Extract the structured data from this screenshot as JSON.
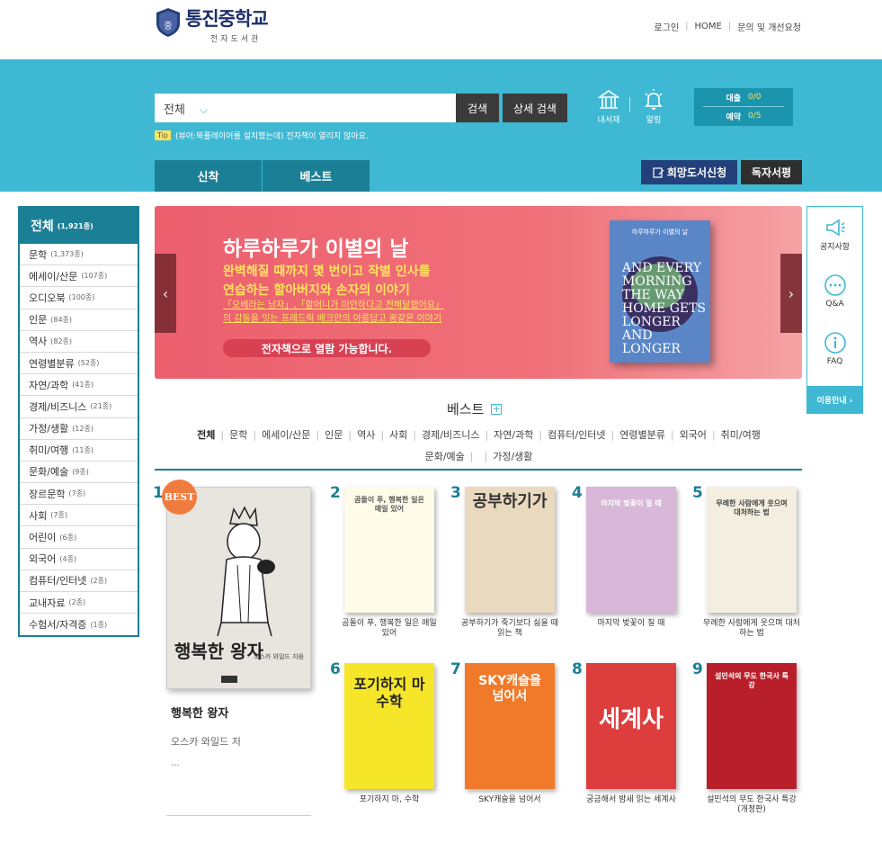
{
  "header": {
    "school_name": "통진중학교",
    "library_name": "전자도서관",
    "emblem_letter": "중",
    "links": [
      "로그인",
      "HOME",
      "문의 및 개선요청"
    ]
  },
  "search": {
    "scope": "전체",
    "search_label": "검색",
    "advanced_label": "상세 검색",
    "tip_badge": "Tip",
    "tip_text": "(뷰어:북플레이어를 설치했는데) 전자책이 열리지 않아요."
  },
  "quick": {
    "my_library": "내서재",
    "alarm": "알림",
    "loan_label": "대출",
    "loan_value": "0/0",
    "reserve_label": "예약",
    "reserve_value": "0/5"
  },
  "tabs": [
    "신착",
    "베스트"
  ],
  "buttons": {
    "hope": "희망도서신청",
    "review": "독자서평"
  },
  "sidebar": {
    "title": "전체",
    "total": "(1,921종)",
    "items": [
      {
        "label": "문학",
        "count": "(1,373종)"
      },
      {
        "label": "에세이/산문",
        "count": "(107종)"
      },
      {
        "label": "오디오북",
        "count": "(100종)"
      },
      {
        "label": "인문",
        "count": "(84종)"
      },
      {
        "label": "역사",
        "count": "(82종)"
      },
      {
        "label": "연령별분류",
        "count": "(52종)"
      },
      {
        "label": "자연/과학",
        "count": "(41종)"
      },
      {
        "label": "경제/비즈니스",
        "count": "(21종)"
      },
      {
        "label": "가정/생활",
        "count": "(12종)"
      },
      {
        "label": "취미/여행",
        "count": "(11종)"
      },
      {
        "label": "문화/예술",
        "count": "(9종)"
      },
      {
        "label": "장르문학",
        "count": "(7종)"
      },
      {
        "label": "사회",
        "count": "(7종)"
      },
      {
        "label": "어린이",
        "count": "(6종)"
      },
      {
        "label": "외국어",
        "count": "(4종)"
      },
      {
        "label": "컴퓨터/인터넷",
        "count": "(2종)"
      },
      {
        "label": "교내자료",
        "count": "(2종)"
      },
      {
        "label": "수험서/자격증",
        "count": "(1종)"
      }
    ]
  },
  "slider": {
    "title": "하루하루가 이별의 날",
    "sub1": "완벽해질 때까지 몇 번이고 작별 인사를",
    "sub2": "연습하는 할아버지와 손자의 이야기",
    "desc1": "「오베라는 남자」,「할머니가 미안하다고 전해달랬어요」",
    "desc2": "의 감동을 잇는 프레드릭 배크만의 아름답고 꿈같은 이야기",
    "button": "전자책으로 열람 가능합니다.",
    "book_top": "하루하루가 이별의 날",
    "book_text": "AND EVERY MORNING THE WAY HOME GETS LONGER AND LONGER",
    "prev": "‹",
    "next": "›"
  },
  "side_panel": {
    "notice": "공지사항",
    "qa": "Q&A",
    "faq": "FAQ",
    "guide": "이용안내 ›"
  },
  "best": {
    "title": "베스트",
    "plus": "+",
    "categories": [
      "전체",
      "문학",
      "에세이/산문",
      "인문",
      "역사",
      "사회",
      "경제/비즈니스",
      "자연/과학",
      "컴퓨터/인터넷",
      "연령별분류",
      "외국어",
      "취미/여행",
      "문화/예술",
      "가정/생활"
    ],
    "badge": "BEST",
    "top": {
      "rank": "1",
      "title": "행복한 왕자",
      "author": "오스카 와일드 저",
      "desc": "...",
      "cover_author": "오스카 와일드 지음"
    },
    "books": [
      {
        "rank": "2",
        "caption": "곰돌이 푸, 행복한 일은 매일 있어",
        "cover": "곰돌이 푸, 행복한 일은 매일 있어"
      },
      {
        "rank": "3",
        "caption": "공부하기가 죽기보다 싫을 때 읽는 책",
        "cover": "공부하기가"
      },
      {
        "rank": "4",
        "caption": "마지막 벚꽃이 질 때",
        "cover": "마지막 벚꽃이 질 때"
      },
      {
        "rank": "5",
        "caption": "무례한 사람에게 웃으며 대처하는 법",
        "cover": "무례한 사람에게 웃으며 대처하는 법"
      },
      {
        "rank": "6",
        "caption": "포기하지 마, 수학",
        "cover": "포기하지 마 수학"
      },
      {
        "rank": "7",
        "caption": "SKY캐슬을 넘어서",
        "cover": "SKY캐슬을 넘어서"
      },
      {
        "rank": "8",
        "caption": "궁금해서 밤새 읽는 세계사",
        "cover": "세계사"
      },
      {
        "rank": "9",
        "caption": "설민석의 무도 한국사 특강 (개정판)",
        "cover": "설민석의 무도 한국사 특강"
      }
    ]
  }
}
